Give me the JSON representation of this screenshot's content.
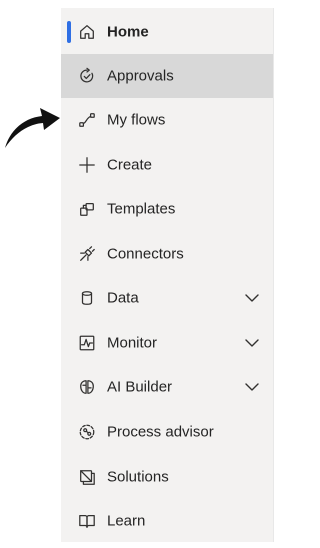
{
  "nav": {
    "items": [
      {
        "label": "Home",
        "icon": "home-icon",
        "active": true
      },
      {
        "label": "Approvals",
        "icon": "approvals-icon",
        "selected": true
      },
      {
        "label": "My flows",
        "icon": "flow-icon"
      },
      {
        "label": "Create",
        "icon": "plus-icon"
      },
      {
        "label": "Templates",
        "icon": "templates-icon"
      },
      {
        "label": "Connectors",
        "icon": "plug-icon"
      },
      {
        "label": "Data",
        "icon": "database-icon",
        "expandable": true
      },
      {
        "label": "Monitor",
        "icon": "monitor-icon",
        "expandable": true
      },
      {
        "label": "AI Builder",
        "icon": "brain-icon",
        "expandable": true
      },
      {
        "label": "Process advisor",
        "icon": "process-advisor-icon"
      },
      {
        "label": "Solutions",
        "icon": "solutions-icon"
      },
      {
        "label": "Learn",
        "icon": "book-icon"
      }
    ]
  },
  "colors": {
    "active_bar": "#2f6fe4",
    "selected_bg": "#d8d8d8",
    "nav_bg": "#f3f2f1"
  }
}
